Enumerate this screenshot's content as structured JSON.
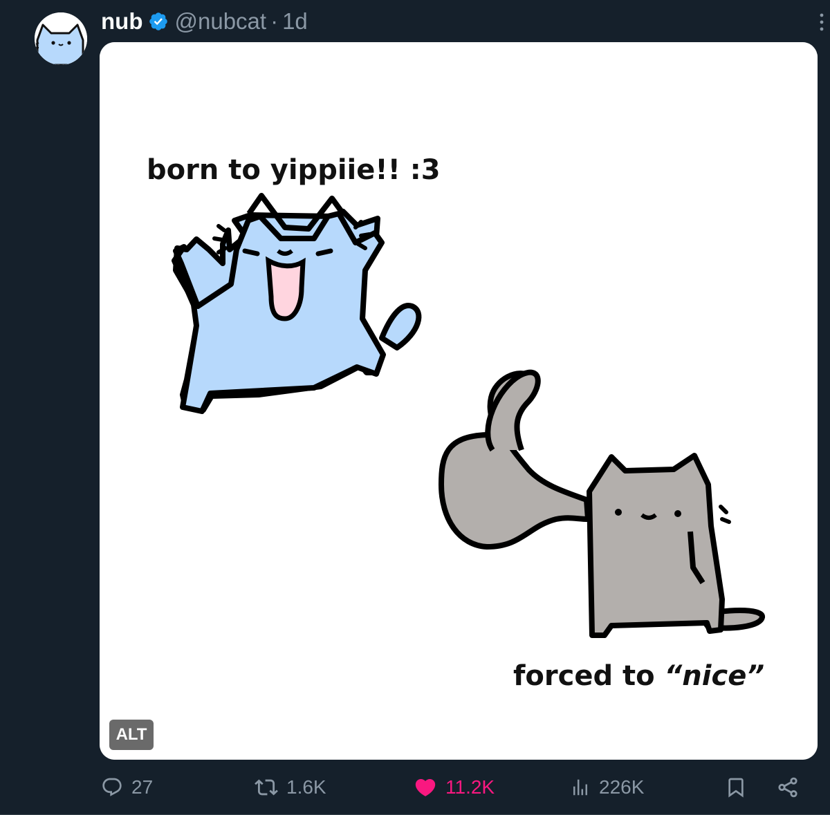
{
  "tweet": {
    "author": {
      "display_name": "nub",
      "handle": "@nubcat",
      "verified": true,
      "avatar_icon": "cat-avatar-icon"
    },
    "separator": "·",
    "time": "1d",
    "media": {
      "top_text": "born to yippiie!! :3",
      "bottom_text_prefix": "forced to ",
      "bottom_text_quoted": "“nice”",
      "alt_label": "ALT"
    },
    "actions": {
      "reply_count": "27",
      "retweet_count": "1.6K",
      "like_count": "11.2K",
      "view_count": "226K"
    }
  },
  "colors": {
    "background": "#15202b",
    "primary_text": "#f7f9f9",
    "secondary_text": "#8b98a5",
    "verified_blue": "#1d9bf0",
    "like_pink": "#f91880",
    "blue_cat": "#b7d9fc",
    "gray_cat": "#b3afac"
  }
}
